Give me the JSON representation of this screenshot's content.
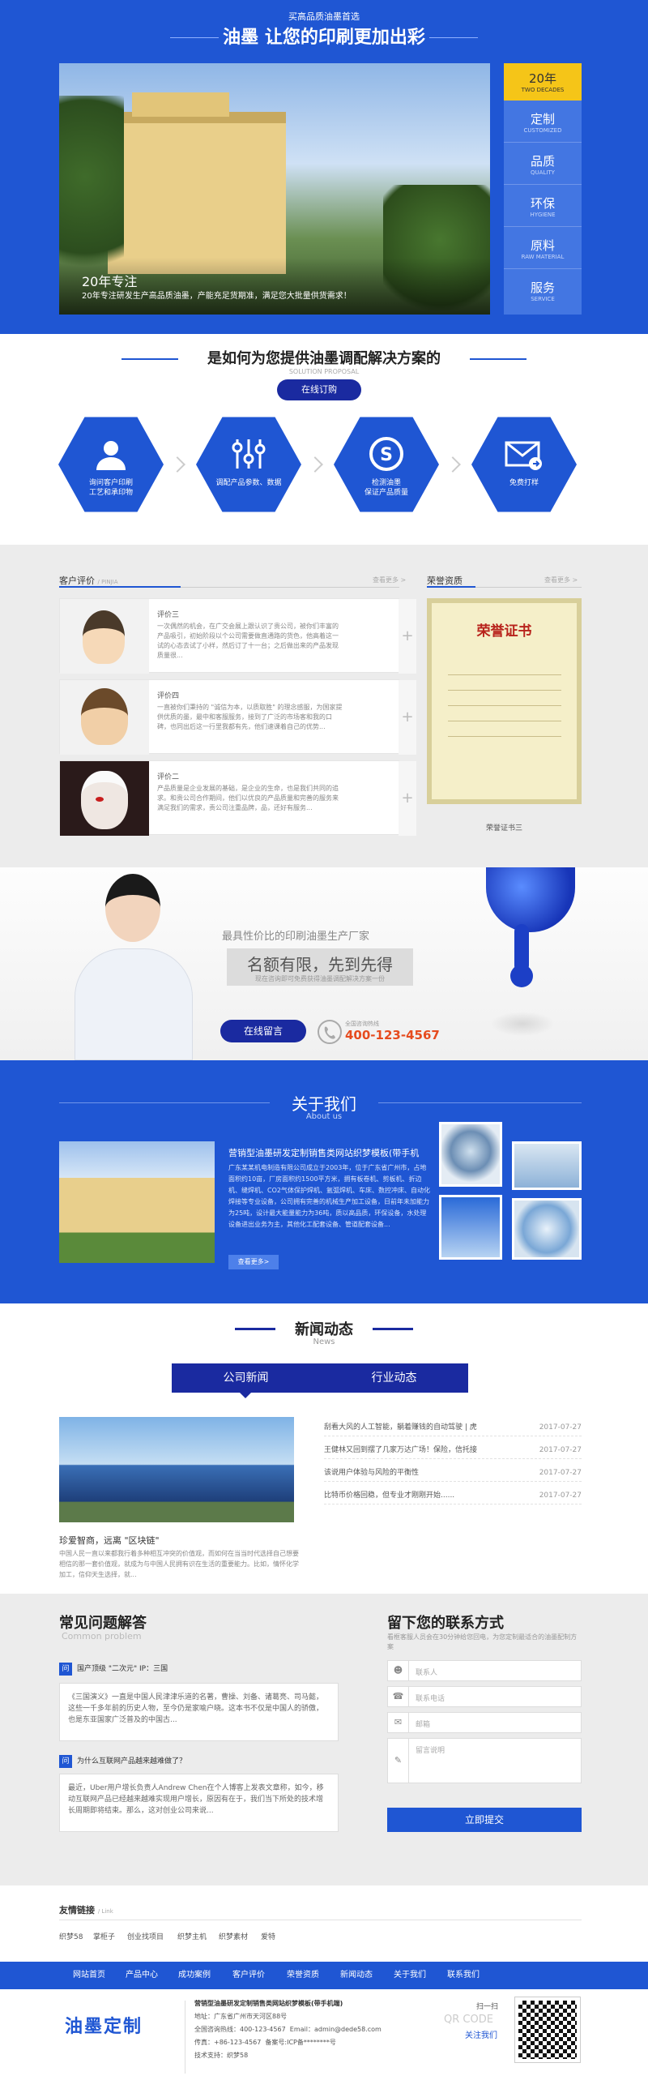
{
  "hero": {
    "top_small": "买高品质油墨首选",
    "headline": "油墨 让您的印刷更加出彩",
    "slide_title": "20年专注",
    "slide_desc": "20年专注研发生产高品质油墨，产能充足货期准，满足您大批量供货需求！",
    "tabs": [
      {
        "label": "20年",
        "sub": "TWO DECADES"
      },
      {
        "label": "定制",
        "sub": "CUSTOMIZED"
      },
      {
        "label": "品质",
        "sub": "QUALITY"
      },
      {
        "label": "环保",
        "sub": "HYGIENE"
      },
      {
        "label": "原料",
        "sub": "RAW MATERIAL"
      },
      {
        "label": "服务",
        "sub": "SERVICE"
      }
    ]
  },
  "solution": {
    "title": "是如何为您提供油墨调配解决方案的",
    "sub": "SOLUTION PROPOSAL",
    "button": "在线订购",
    "steps": [
      {
        "label": "询问客户印刷\n工艺和承印物",
        "icon": "users-icon"
      },
      {
        "label": "调配产品参数、数据",
        "icon": "sliders-icon"
      },
      {
        "label": "检测油墨\n保证产品质量",
        "icon": "quality-icon"
      },
      {
        "label": "免费打样",
        "icon": "mail-icon"
      }
    ]
  },
  "reviews": {
    "title": "客户评价",
    "title_en": "/ PINJIA",
    "more": "查看更多 >",
    "items": [
      {
        "name": "评价三",
        "text": "一次偶然的机会，在广交会展上跟认识了贵公司，被你们丰富的产品吸引，初始阶段以个公司需要做直通路的货色，他高着这一试的心态去试了小样，然后订了十一台；之后做出来的产品发现质量很..."
      },
      {
        "name": "评价四",
        "text": "一直被你们秉持的 \"诚信为本，以质取胜\" 的理念感服，为国家提供优质的墨，最中和客服服务，接到了广泛的市场客和我的口碑，也同出后这一行里我都有先，他们速课着自己的优势..."
      },
      {
        "name": "评价二",
        "text": "产品质量是企业发展的基础，是企业的生命，也是我们共同的追求。和贵公司合作期间，他们以优良的产品质量和完善的服务来满足我们的需求，责公司注重品牌，品，还好有服务..."
      }
    ]
  },
  "honor": {
    "title": "荣誉资质",
    "more": "查看更多 >",
    "cert_title": "荣誉证书",
    "caption": "荣誉证书三"
  },
  "cta": {
    "tagline": "最具性价比的印刷油墨生产厂家",
    "big": "名额有限，先到先得",
    "small": "现在咨询即可免费获得油墨调配解决方案一份",
    "button": "在线留言",
    "hotline_label": "全国咨询热线",
    "phone": "400-123-4567"
  },
  "about": {
    "title": "关于我们",
    "sub": "About us",
    "company": "营销型油墨研发定制销售类网站织梦模板(带手机",
    "desc": "广东某某机电制造有限公司成立于2003年，位于广东省广州市，占地面积约10亩，厂房面积约1500平方米，拥有板卷机、剪板机、折边机、缝焊机、CO2气体保护焊机、氩弧焊机、车床、数控冲床、自动化焊接等专业设备，公司拥有完善的机械生产加工设备，日前年未加能力为25吨，设计最大能量能力为36吨，质以高品质，环保设备，水处理设备进出业务为主，其他化工配套设备、管道配套设备...",
    "button": "查看更多>"
  },
  "news": {
    "title": "新闻动态",
    "sub": "News",
    "tabs": [
      "公司新闻",
      "行业动态"
    ],
    "feature_title": "珍爱智商，远离 \"区块链\"",
    "feature_desc": "中国人民一直以来都我行着多种相互冲突的价值观，而如何在当当时代选择自己想要相信的那一套价值观，就成为与中国人民拥有识在生活的重要能力。比如，情怀化学加工，信仰天生选择，就...",
    "items": [
      {
        "title": "刮看大风的人工智能，躺着赚钱的自动驾驶 | 虎",
        "date": "2017-07-27"
      },
      {
        "title": "王健林又回到摆了几家万达广场！保险，信托接",
        "date": "2017-07-27"
      },
      {
        "title": "该说用户体验与风险的平衡性",
        "date": "2017-07-27"
      },
      {
        "title": "比特币价格回稳，但专业才刚刚开始......",
        "date": "2017-07-27"
      }
    ]
  },
  "faq": {
    "title": "常见问题解答",
    "sub": "Common problem",
    "items": [
      {
        "q": "国产顶级 \"二次元\" IP：三国",
        "a": "《三国演义》一直是中国人民津津乐道的名著，曹操、刘备、诸葛亮、司马懿，这些一千多年前的历史人物，至今仍是家喻户晓。这本书不仅是中国人的骄傲，也是东亚国家广泛普及的中国古..."
      },
      {
        "q": "为什么互联网产品越来越难做了？",
        "a": "最近，Uber用户增长负责人Andrew Chen在个人博客上发表文章称，如今，移动互联网产品已经越来越难实现用户增长，原因有在于，我们当下所处的技术增长周期即将结束。那么，这对创业公司来说..."
      }
    ]
  },
  "contact": {
    "title": "留下您的联系方式",
    "desc": "看框客服人员会在30分钟给您回电，为您定制最适合的油墨配制方案",
    "name_ph": "联系人",
    "phone_ph": "联系电话",
    "email_ph": "邮箱",
    "msg_ph": "留言说明",
    "submit": "立即提交"
  },
  "links": {
    "title": "友情链接",
    "sub": "/ Link",
    "items": [
      "织梦58",
      "掌柜子",
      "创业找项目",
      "织梦主机",
      "织梦素材",
      "爱特"
    ]
  },
  "nav": [
    "网站首页",
    "产品中心",
    "成功案例",
    "客户评价",
    "荣誉资质",
    "新闻动态",
    "关于我们",
    "联系我们"
  ],
  "footer": {
    "logo": "油墨定制",
    "company": "营销型油墨研发定制销售类网站织梦模板(带手机端)",
    "address": "地址：广东省广州市天河区88号",
    "hotline": "全国咨询热线：400-123-4567",
    "email": "Email：admin@dede58.com",
    "fax": "传真：+86-123-4567",
    "icp": "备案号:ICP备********号",
    "support": "技术支持：织梦58",
    "qr_label": "扫一扫",
    "qr_en": "QR CODE",
    "follow": "关注我们"
  },
  "colors": {
    "brand": "#1f56d3",
    "navy": "#1a2aa0",
    "accent_yellow": "#f5c518",
    "phone_red": "#e64b1e"
  }
}
